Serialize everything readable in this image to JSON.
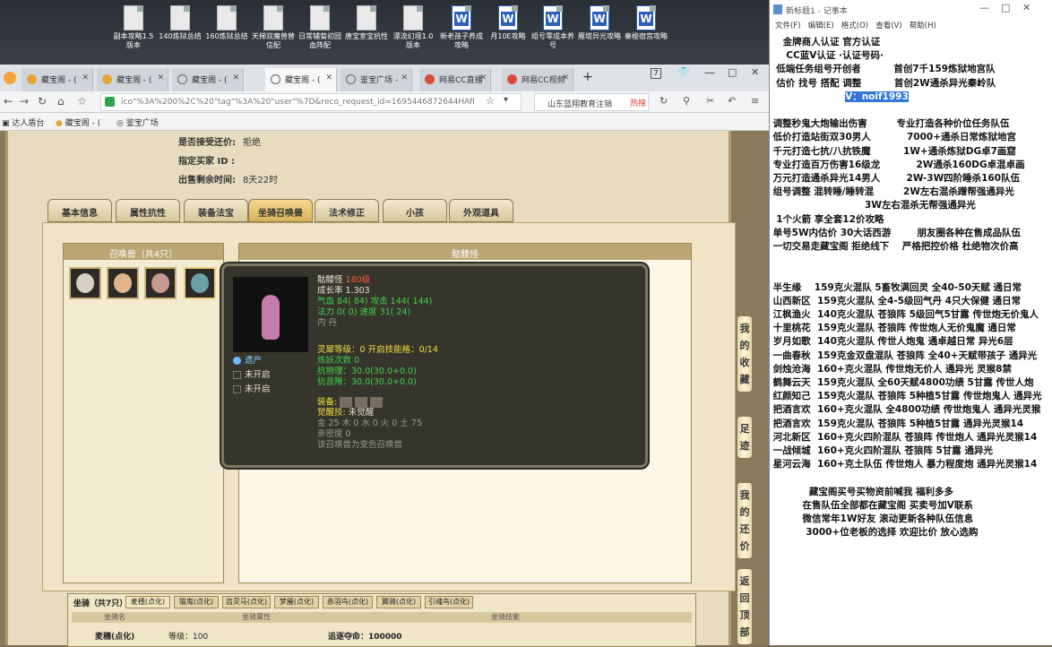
{
  "desktop_icons": [
    {
      "label": "副本攻略1.5版本",
      "type": "doc"
    },
    {
      "label": "140炼狱总结",
      "type": "doc"
    },
    {
      "label": "160炼狱总结",
      "type": "doc"
    },
    {
      "label": "天梯双魔兽替信配",
      "type": "doc"
    },
    {
      "label": "日常辅菊初园血阵配",
      "type": "doc"
    },
    {
      "label": "唐宝室宝抗性",
      "type": "doc"
    },
    {
      "label": "漂流幻境1.0版本",
      "type": "doc"
    },
    {
      "label": "新老孩子养成攻略",
      "type": "word"
    },
    {
      "label": "月10E攻略",
      "type": "word"
    },
    {
      "label": "组号零成本养号",
      "type": "word"
    },
    {
      "label": "雁塔异光攻略",
      "type": "word"
    },
    {
      "label": "秦梭宿宫攻略",
      "type": "word"
    }
  ],
  "browser": {
    "tabs": [
      "藏宝阁 - (",
      "藏宝阁 - (",
      "藏宝阁 - (",
      "藏宝阁 - (",
      "鉴宝广场 -",
      "网易CC直播",
      "网易CC视频"
    ],
    "new_tab": "+",
    "tab_counter": "7",
    "url": "ico\"%3A%200%2C%20\"tag\"%3A%20\"user\"%7D&reco_request_id=1695446872644HAfI",
    "search_text": "山东蓝翔教育注销",
    "hot_label": "热搜",
    "bookmarks": [
      "达人盾台",
      "藏宝阁 - (",
      "鉴宝广场"
    ]
  },
  "sale_info": {
    "bargain_label": "是否接受还价:",
    "bargain_value": "拒绝",
    "buyer_label": "指定买家 ID :",
    "buyer_value": "",
    "remain_label": "出售剩余时间:",
    "remain_value": "8天22时"
  },
  "tabs": [
    "基本信息",
    "属性抗性",
    "装备法宝",
    "坐骑召唤兽",
    "法术修正",
    "小孩",
    "外观道具"
  ],
  "active_tab": 3,
  "pets": {
    "title": "召唤兽（共4只）",
    "detail_title": "骷髅怪"
  },
  "tooltip": {
    "name": "骷髅怪",
    "level": "180级",
    "growth": "成长率 1.303",
    "hp": "气血 84( 84) 攻击 144( 144)",
    "mp": "法力 0( 0) 速度 31( 24)",
    "neidan": "内  丹",
    "skill1": "遗产",
    "skill2": "未开启",
    "skill3": "未开启",
    "lingxi": "灵犀等级：0  开启技能格：0/14",
    "lianyao": "炼妖次数 0",
    "kang_wu": "抗物理：30.0(30.0+0.0)",
    "kang_fa": "抗音障：30.0(30.0+0.0)",
    "equip": "装备:",
    "juexing_label": "觉醒技:",
    "juexing_value": "未觉醒",
    "wuxing": "金 25 木 0 水 0 火 0 土 75",
    "qinmi": "亲密度 0",
    "note": "该召唤兽为变色召唤兽"
  },
  "mount": {
    "title": "坐骑（共7只）",
    "tabs": [
      "麦穗(点化)",
      "猫鬼(点化)",
      "齿灵马(点化)",
      "梦魇(点化)",
      "赤羽鸟(点化)",
      "翼骑(点化)",
      "引魂鸟(点化)"
    ],
    "headers": [
      "坐骑名",
      "坐骑属性",
      "坐骑技能"
    ],
    "row": {
      "name": "麦穗(点化)",
      "level": "等级：100",
      "skill": "追逐夺命：100000"
    }
  },
  "side_buttons": [
    "我的收藏",
    "足迹",
    "我的还价",
    "返回顶部"
  ],
  "notepad": {
    "title": "新标题1 - 记事本",
    "menu": [
      "文件(F)",
      "编辑(E)",
      "格式(O)",
      "查看(V)",
      "帮助(H)"
    ],
    "lines": [
      "    金牌商人认证 官方认证",
      "     CC蓝V认证 ·认证号码·",
      "  低端任务组号开创者          首创7千159炼狱地宫队",
      "  估价 找号 搭配 调整          首创2W通杀异光秦岭队",
      "                       V：noif1993",
      "",
      " 调整秒鬼大炮输出伤害         专业打造各种价位任务队伍",
      " 低价打造站街双30男人           7000+通杀日常炼狱地宫",
      " 千元打造七抗/八抗铁魔          1W+通杀炼狱DG卓7画窟",
      " 专业打造百万伤害16级龙           2W通杀160DG卓混卓画",
      " 万元打造通杀异光14男人        2W-3W四阶睡杀160队伍",
      " 组号调整 混转睡/睡转混         2W左右混杀蹭帮强通异光",
      "                             3W左右混杀无帮强通异光",
      "  1个火箭 享全套12价攻略",
      " 单号5W内估价 30大话西游        朋友圈各种在售成品队伍",
      " 一切交易走藏宝阁 拒绝线下    严格把控价格 杜绝物次价高",
      "",
      "",
      " 半生缘    159克火混队 5畜牧满回灵 全40-50天赋 通日常",
      " 山西新区  159克火混队 全4-5级回气丹 4只大保健 通日常",
      " 江枫渔火  140克火混队 苍狼阵 5级回气5甘露 传世炮无价鬼人",
      " 十里桃花  159克火混队 苍狼阵 传世炮人无价鬼魔 通日常",
      " 岁月如歌  140克火混队 传世人炮鬼 通卓越日常 异光6层",
      " 一曲春秋  159克金双盘混队 苍狼阵 全40+天赋带孩子 通异光",
      " 剑烛沧海  160+克火混队 传世炮无价人 通异光 灵猴8禁",
      " 鹤舞云天  159克火混队 全60天赋4800功绩 5甘露 传世人炮",
      " 红颜知己  159克火混队 苍狼阵 5种植5甘露 传世炮鬼人 通异光",
      " 把酒言欢  160+克火混队 全4800功绩 传世炮鬼人 通异光灵猴",
      " 把酒言欢  159克火混队 苍狼阵 5种植5甘露 通异光灵猴14",
      " 河北新区  160+克火四阶混队 苍狼阵 传世炮人 通异光灵猴14",
      " 一战倾城  160+克火四阶混队 苍狼阵 5甘露 通异光",
      " 星河云海  160+克土队伍 传世炮人 暴力程度炮 通异光灵猴14",
      "",
      "            藏宝阁买号买物资前喊我 福利多多",
      "          在售队伍全部都在藏宝阁 买卖号加V联系",
      "          微信常年1W好友 滚动更新各种队伍信息",
      "           3000+位老板的选择 欢迎比价 放心选购"
    ]
  }
}
